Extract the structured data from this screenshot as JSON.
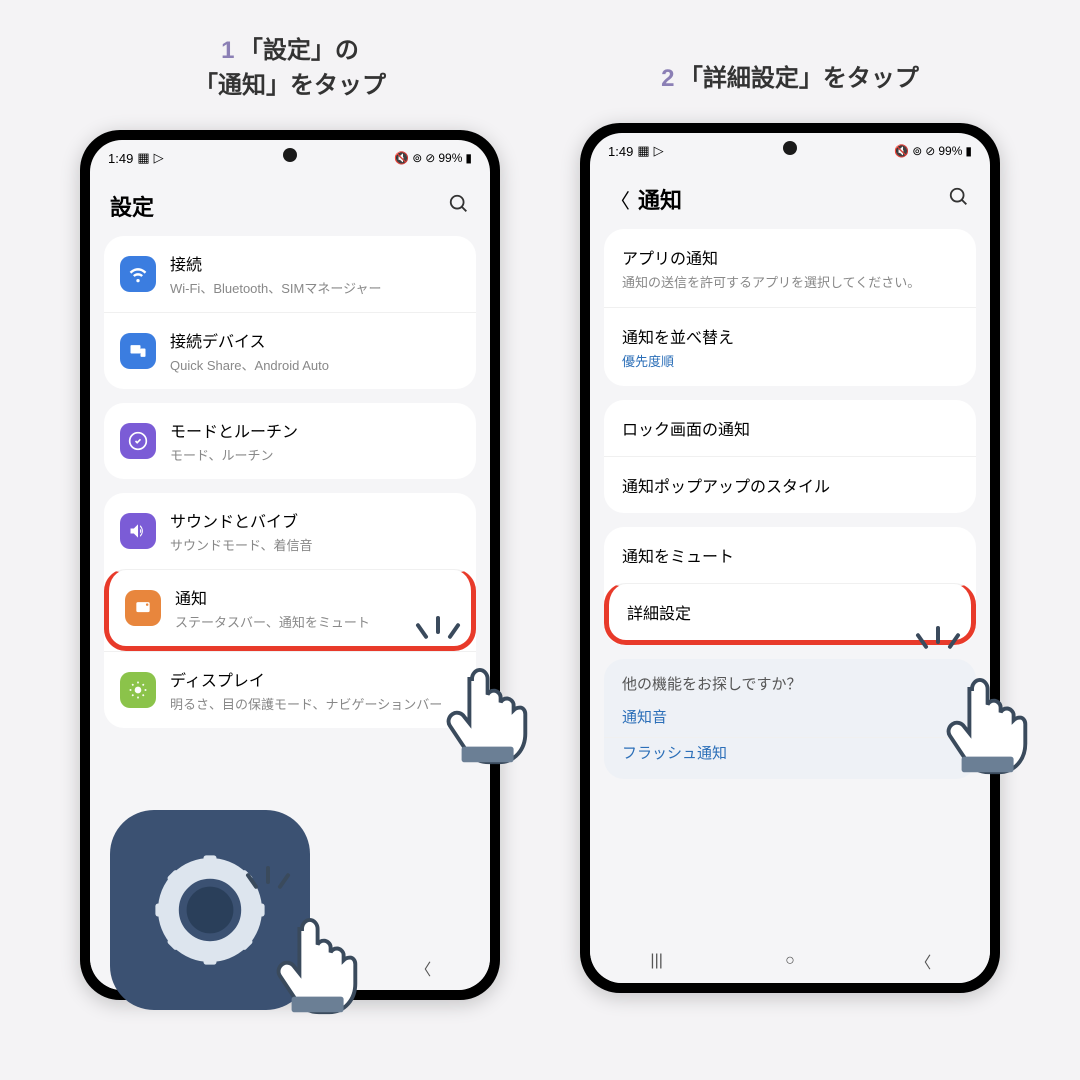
{
  "captions": {
    "step1_num": "1",
    "step1_txt": "「設定」の\n「通知」をタップ",
    "step2_num": "2",
    "step2_txt": "「詳細設定」をタップ"
  },
  "status": {
    "time": "1:49",
    "battery": "99%"
  },
  "phone1": {
    "header": "設定",
    "groups": [
      {
        "items": [
          {
            "icon": "wifi",
            "color": "#3b7de0",
            "title": "接続",
            "sub": "Wi-Fi、Bluetooth、SIMマネージャー"
          },
          {
            "icon": "devices",
            "color": "#3b7de0",
            "title": "接続デバイス",
            "sub": "Quick Share、Android Auto"
          }
        ]
      },
      {
        "items": [
          {
            "icon": "routine",
            "color": "#7b5cd6",
            "title": "モードとルーチン",
            "sub": "モード、ルーチン"
          }
        ]
      },
      {
        "items": [
          {
            "icon": "sound",
            "color": "#7b5cd6",
            "title": "サウンドとバイブ",
            "sub": "サウンドモード、着信音"
          },
          {
            "icon": "notif",
            "color": "#e8863d",
            "title": "通知",
            "sub": "ステータスバー、通知をミュート",
            "highlight": true
          },
          {
            "icon": "display",
            "color": "#8bc34a",
            "title": "ディスプレイ",
            "sub": "明るさ、目の保護モード、ナビゲーションバー"
          }
        ]
      }
    ]
  },
  "phone2": {
    "header": "通知",
    "groups": [
      {
        "items": [
          {
            "title": "アプリの通知",
            "sub": "通知の送信を許可するアプリを選択してください。"
          },
          {
            "title": "通知を並べ替え",
            "sub": "優先度順",
            "subLink": true
          }
        ]
      },
      {
        "items": [
          {
            "title": "ロック画面の通知"
          },
          {
            "title": "通知ポップアップのスタイル"
          }
        ]
      },
      {
        "items": [
          {
            "title": "通知をミュート"
          },
          {
            "title": "詳細設定",
            "highlight": true
          }
        ]
      }
    ],
    "footer": {
      "heading": "他の機能をお探しですか？",
      "links": [
        "通知音",
        "フラッシュ通知"
      ]
    }
  }
}
